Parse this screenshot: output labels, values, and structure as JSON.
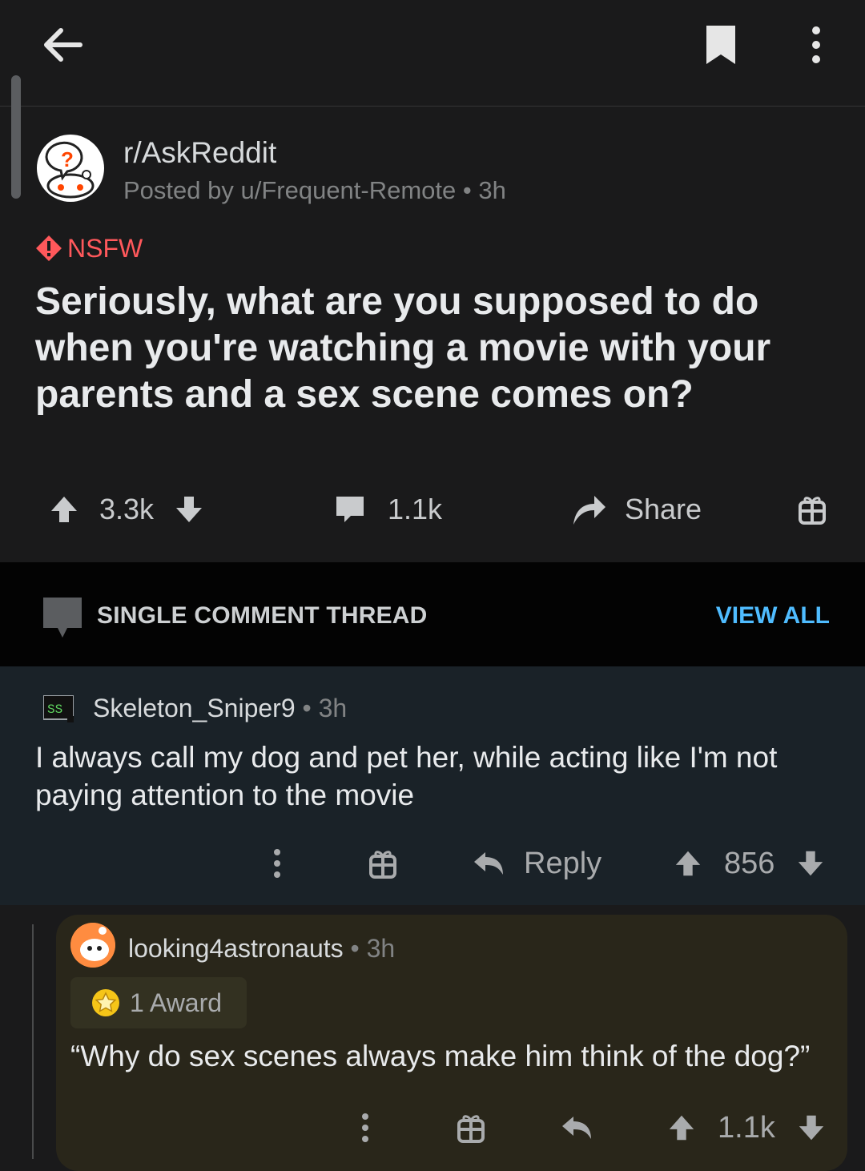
{
  "topbar": {
    "back_icon": "arrow-left-icon",
    "bookmark_icon": "bookmark-icon",
    "more_icon": "vertical-dots-icon"
  },
  "post": {
    "subreddit": "r/AskReddit",
    "posted_by": "Posted by u/Frequent-Remote",
    "age": "3h",
    "nsfw_label": "NSFW",
    "title": "Seriously, what are you supposed to do when you're watching a movie with your parents and a sex scene comes on?",
    "score": "3.3k",
    "comments": "1.1k",
    "share_label": "Share"
  },
  "thread": {
    "label": "SINGLE COMMENT THREAD",
    "view_all": "VIEW ALL"
  },
  "comment1": {
    "username": "Skeleton_Sniper9",
    "age": "3h",
    "body": "I always call my dog and pet her, while acting like I'm not paying attention to the movie",
    "reply_label": "Reply",
    "score": "856"
  },
  "comment2": {
    "username": "looking4astronauts",
    "age": "3h",
    "award": "1 Award",
    "body": "“Why do sex scenes always make him think of the dog?”",
    "score": "1.1k"
  },
  "colors": {
    "background": "#1a1a1b",
    "nsfw": "#ff585b",
    "link": "#4fbcff",
    "comment_bg": "#1a2228",
    "reply_bg": "#29261a"
  }
}
